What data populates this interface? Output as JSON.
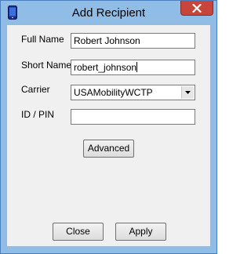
{
  "window": {
    "title": "Add Recipient",
    "icon": "phone-icon"
  },
  "form": {
    "full_name": {
      "label": "Full Name",
      "value": "Robert Johnson"
    },
    "short_name": {
      "label": "Short Name",
      "value": "robert_johnson"
    },
    "carrier": {
      "label": "Carrier",
      "value": "USAMobilityWCTP"
    },
    "id_pin": {
      "label": "ID / PIN",
      "value": ""
    }
  },
  "buttons": {
    "advanced": "Advanced",
    "close": "Close",
    "apply": "Apply"
  },
  "colors": {
    "frame": "#8fbde6",
    "close_button": "#c7463c",
    "dialog_bg": "#f0f0f0"
  }
}
